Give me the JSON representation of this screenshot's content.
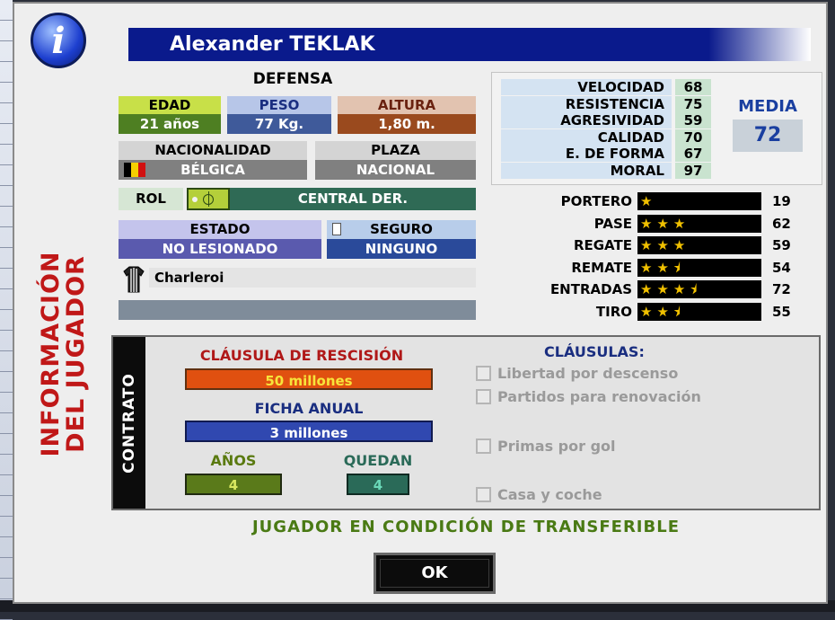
{
  "player": {
    "name": "Alexander TEKLAK",
    "position": "DEFENSA"
  },
  "side_title": [
    "INFORMACIÓN",
    "DEL JUGADOR"
  ],
  "profile": {
    "edad_label": "EDAD",
    "edad": "21 años",
    "peso_label": "PESO",
    "peso": "77 Kg.",
    "altura_label": "ALTURA",
    "altura": "1,80 m.",
    "nacionalidad_label": "NACIONALIDAD",
    "nacionalidad": "BÉLGICA",
    "plaza_label": "PLAZA",
    "plaza": "NACIONAL",
    "rol_label": "ROL",
    "rol": "CENTRAL DER.",
    "estado_label": "ESTADO",
    "estado": "NO LESIONADO",
    "seguro_label": "SEGURO",
    "seguro": "NINGUNO",
    "club": "Charleroi"
  },
  "attributes": [
    {
      "name": "VELOCIDAD",
      "value": "68"
    },
    {
      "name": "RESISTENCIA",
      "value": "75"
    },
    {
      "name": "AGRESIVIDAD",
      "value": "59"
    },
    {
      "name": "CALIDAD",
      "value": "70"
    },
    {
      "name": "E. DE FORMA",
      "value": "67"
    },
    {
      "name": "MORAL",
      "value": "97"
    }
  ],
  "media": {
    "label": "MEDIA",
    "value": "72"
  },
  "skills": [
    {
      "name": "PORTERO",
      "stars": 1,
      "value": "19"
    },
    {
      "name": "PASE",
      "stars": 3,
      "value": "62"
    },
    {
      "name": "REGATE",
      "stars": 3,
      "value": "59"
    },
    {
      "name": "REMATE",
      "stars": 2.5,
      "value": "54"
    },
    {
      "name": "ENTRADAS",
      "stars": 3.5,
      "value": "72"
    },
    {
      "name": "TIRO",
      "stars": 2.5,
      "value": "55"
    }
  ],
  "contract": {
    "side_label": "CONTRATO",
    "clausula_label": "CLÁUSULA DE RESCISIÓN",
    "clausula": "50 millones",
    "ficha_label": "FICHA ANUAL",
    "ficha": "3 millones",
    "anos_label": "AÑOS",
    "anos": "4",
    "quedan_label": "QUEDAN",
    "quedan": "4",
    "clausulas_title": "CLÁUSULAS:",
    "clausulas": [
      "Libertad por descenso",
      "Partidos para renovación",
      "Primas por gol",
      "Casa y coche"
    ]
  },
  "status": "JUGADOR EN CONDICIÓN DE TRANSFERIBLE",
  "ok_label": "OK",
  "colors": {
    "title_bar": "#0a1a8c",
    "vertical_title": "#c01818",
    "stars": "#f0c000",
    "status_text": "#4a7a14"
  }
}
